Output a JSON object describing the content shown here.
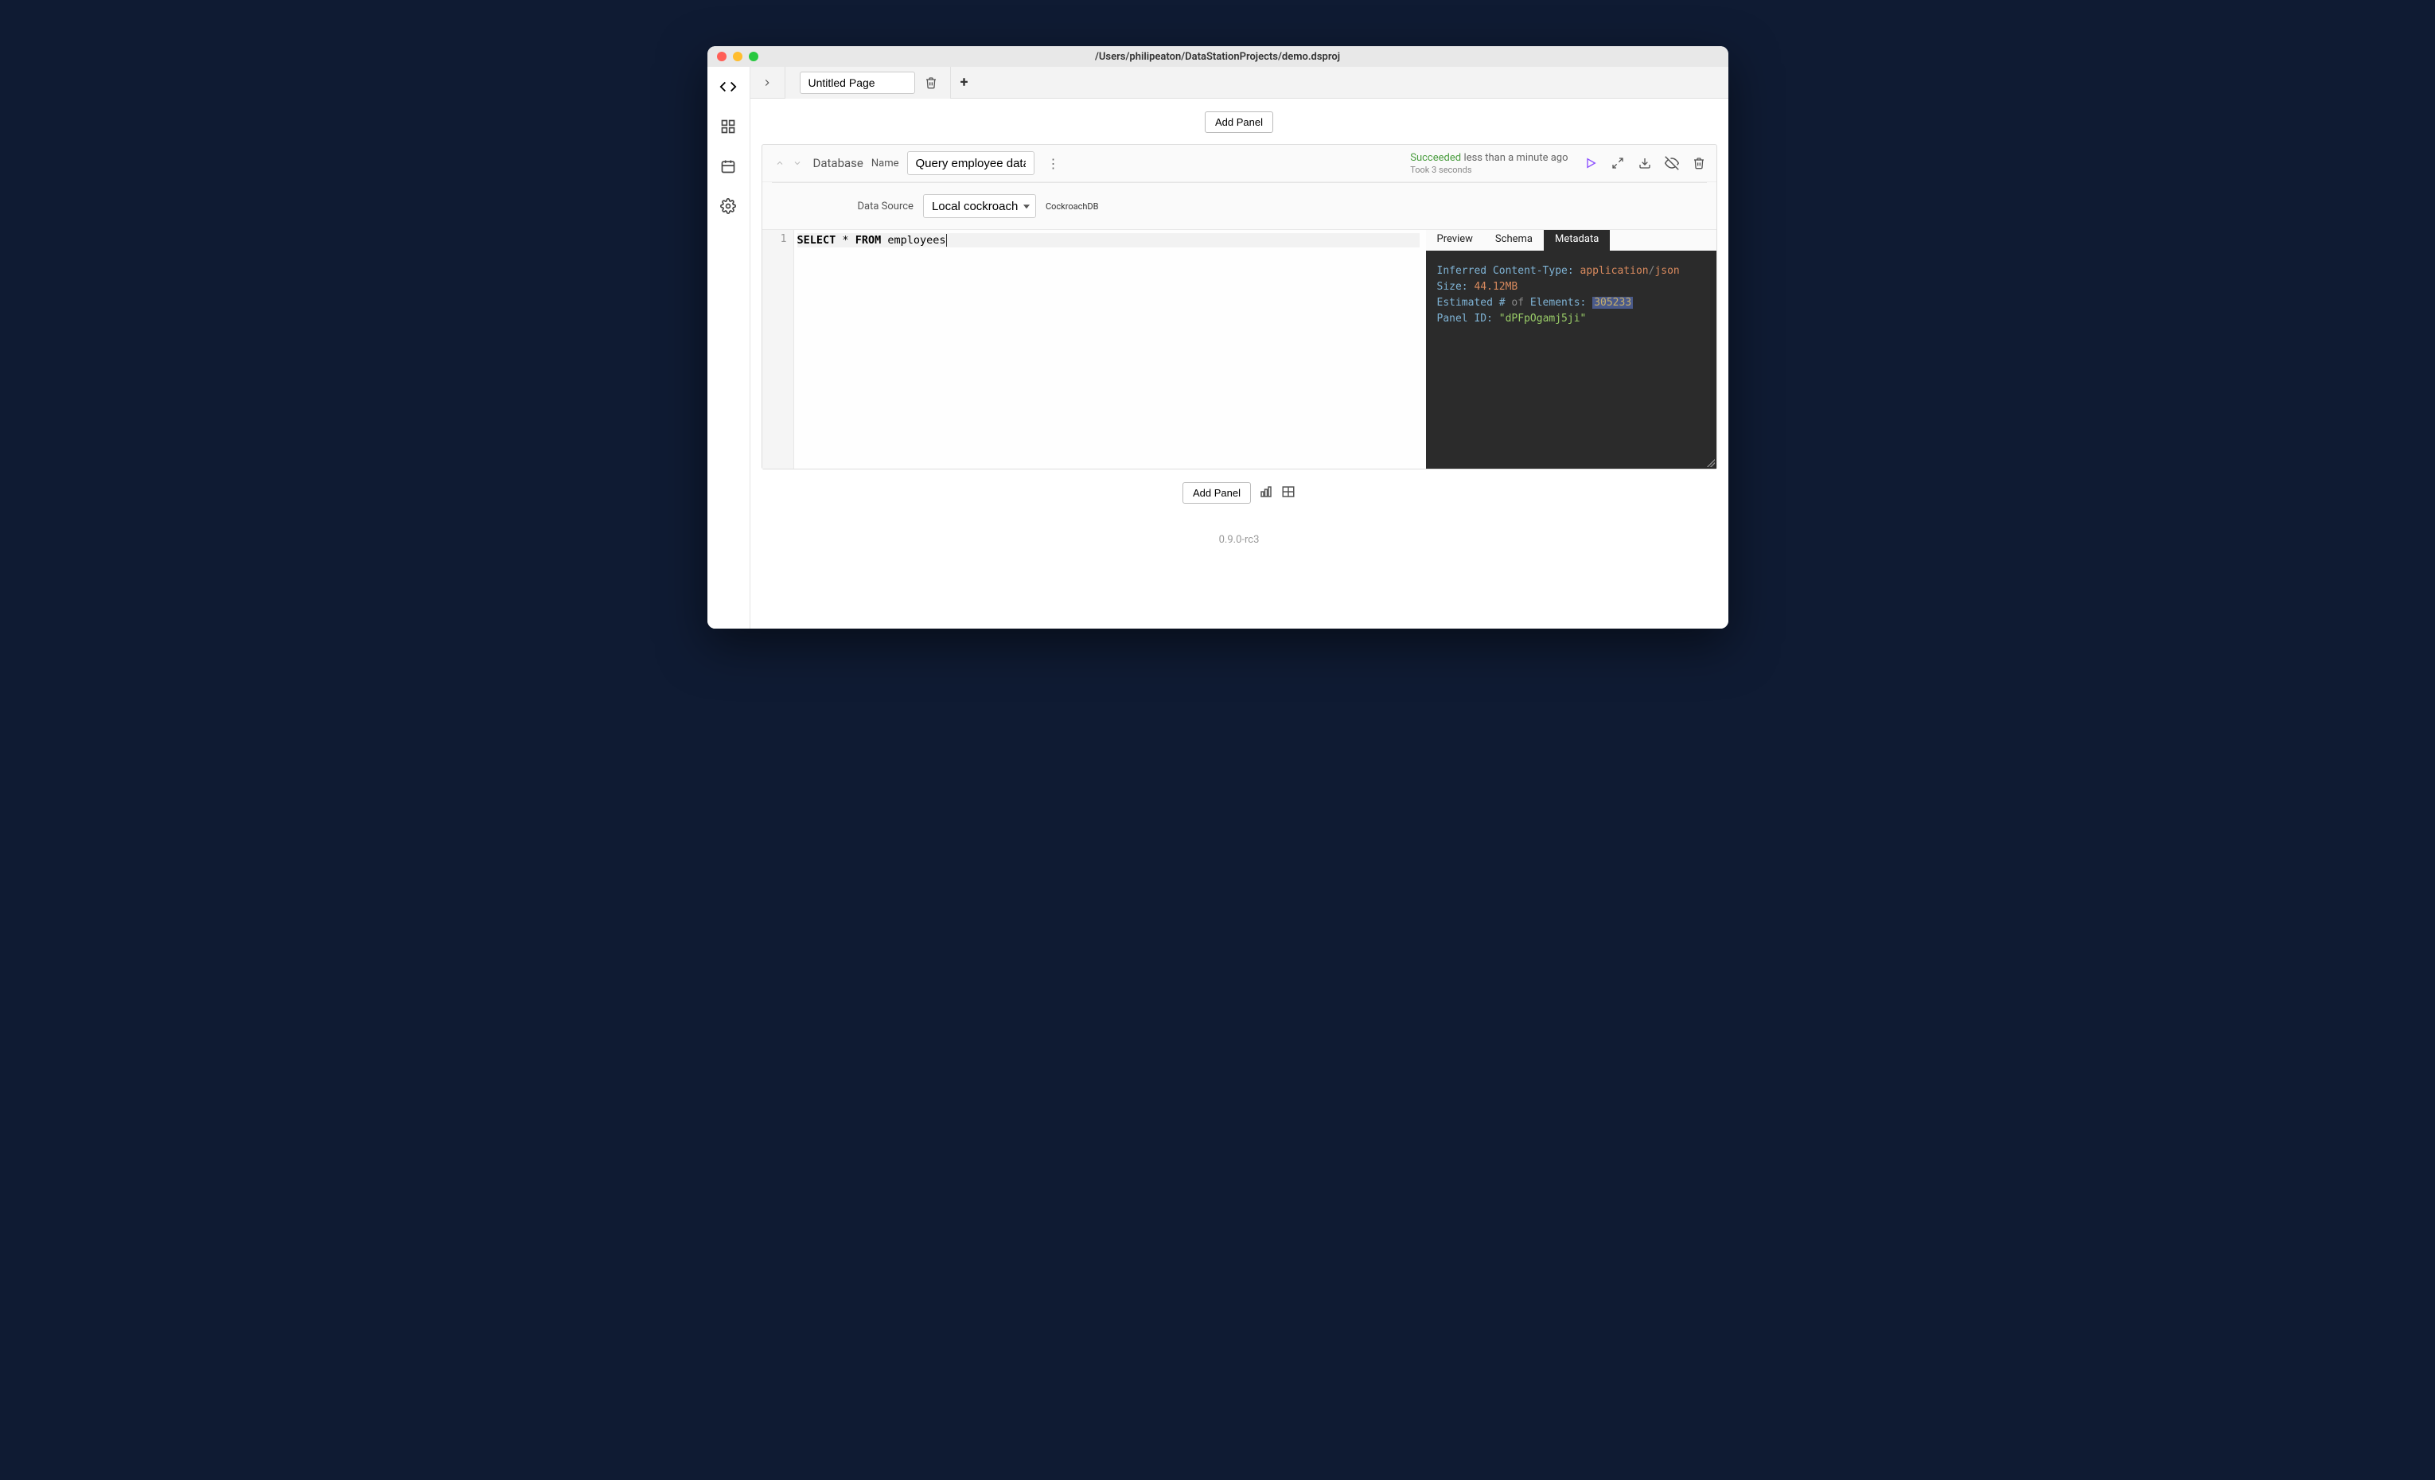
{
  "window": {
    "title": "/Users/philipeaton/DataStationProjects/demo.dsproj"
  },
  "tabs": {
    "page_name": "Untitled Page"
  },
  "toolbar": {
    "add_panel": "Add Panel"
  },
  "panel": {
    "type_label": "Database",
    "name_label": "Name",
    "name_value": "Query employee data",
    "status": {
      "state": "Succeeded",
      "ago": "less than a minute ago",
      "took": "Took 3 seconds"
    },
    "datasource": {
      "label": "Data Source",
      "selected": "Local cockroach",
      "db_type": "CockroachDB"
    }
  },
  "code": {
    "line_number": "1",
    "kw_select": "SELECT",
    "kw_star": "*",
    "kw_from": "FROM",
    "ident": "employees"
  },
  "result": {
    "tabs": {
      "preview": "Preview",
      "schema": "Schema",
      "metadata": "Metadata"
    },
    "meta": {
      "ct_key": "Inferred Content-Type:",
      "ct_ns": "application",
      "ct_slash": "/",
      "ct_sub": "json",
      "size_key": "Size:",
      "size_num": "44.12",
      "size_unit": "MB",
      "elem_key1": "Estimated #",
      "elem_of": "of",
      "elem_key2": "Elements:",
      "elem_val": "305233",
      "pid_key": "Panel ID:",
      "pid_val": "\"dPFpOgamj5ji\""
    }
  },
  "footer": {
    "version": "0.9.0-rc3"
  }
}
